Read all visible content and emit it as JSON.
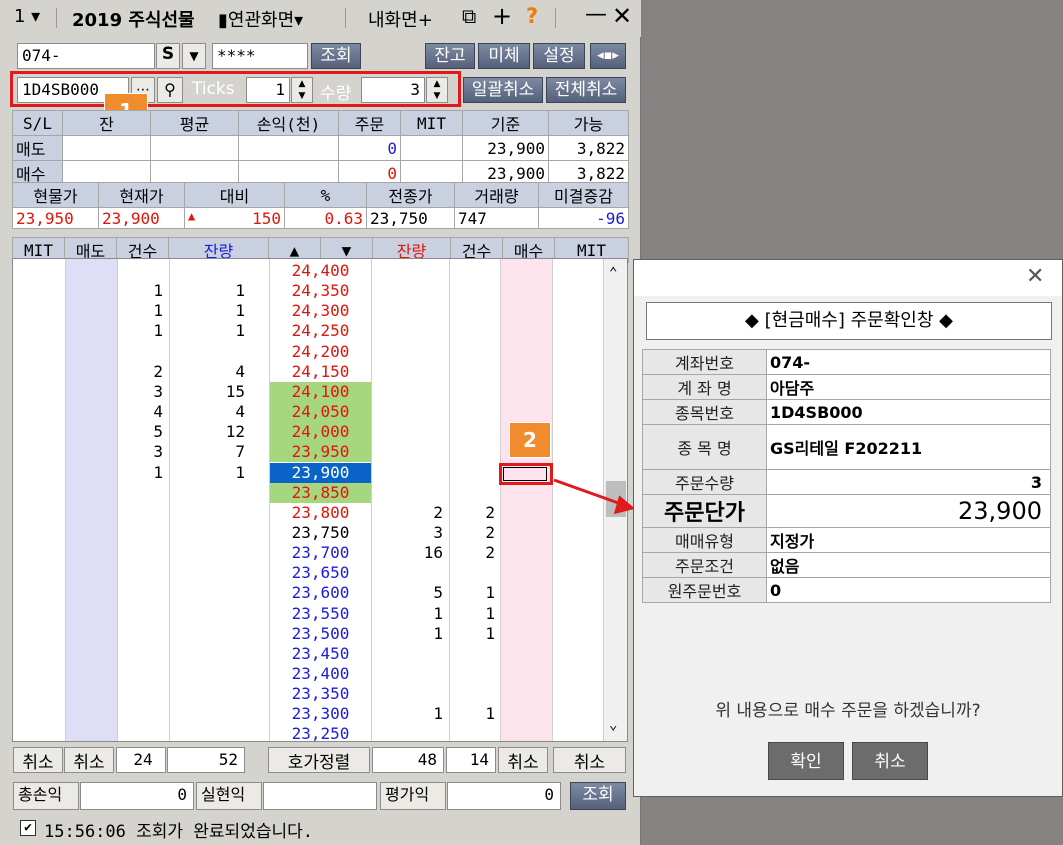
{
  "titlebar": {
    "menu_num": "1",
    "title": "2019 주식선물",
    "linked": "연관화면",
    "myscreen": "내화면",
    "help": "?"
  },
  "account": {
    "number": "074-",
    "s_label": "S",
    "password": "****",
    "inquiry_label": "조회",
    "balance_label": "잔고",
    "unfilled_label": "미체",
    "settings_label": "설정"
  },
  "order": {
    "code": "1D4SB000",
    "ticks_label": "Ticks",
    "ticks_value": "1",
    "qty_label": "수량",
    "qty_value": "3",
    "cancel_all_label": "일괄취소",
    "cancel_total_label": "전체취소"
  },
  "positions": {
    "headers": [
      "S/L",
      "잔",
      "평균",
      "손익(천)",
      "주문",
      "MIT",
      "기준",
      "가능"
    ],
    "rows": [
      {
        "side": "매도",
        "order": "0",
        "base": "23,900",
        "avail": "3,822"
      },
      {
        "side": "매수",
        "order": "0",
        "base": "23,900",
        "avail": "3,822"
      }
    ]
  },
  "quote": {
    "headers": [
      "현물가",
      "현재가",
      "대비",
      "%",
      "전종가",
      "거래량",
      "미결증감"
    ],
    "values": [
      "23,950",
      "23,900",
      "150",
      "0.63",
      "23,750",
      "747",
      "-96"
    ],
    "arrow": "▲"
  },
  "book_headers": [
    "MIT",
    "매도",
    "건수",
    "잔량",
    "▲",
    "▼",
    "잔량",
    "건수",
    "매수",
    "MIT"
  ],
  "book": [
    {
      "price": "24,400",
      "sc": "",
      "sq": "",
      "bq": "",
      "bc": "",
      "pc": "red",
      "hl": ""
    },
    {
      "price": "24,350",
      "sc": "1",
      "sq": "1",
      "bq": "",
      "bc": "",
      "pc": "red",
      "hl": ""
    },
    {
      "price": "24,300",
      "sc": "1",
      "sq": "1",
      "bq": "",
      "bc": "",
      "pc": "red",
      "hl": ""
    },
    {
      "price": "24,250",
      "sc": "1",
      "sq": "1",
      "bq": "",
      "bc": "",
      "pc": "red",
      "hl": ""
    },
    {
      "price": "24,200",
      "sc": "",
      "sq": "",
      "bq": "",
      "bc": "",
      "pc": "red",
      "hl": ""
    },
    {
      "price": "24,150",
      "sc": "2",
      "sq": "4",
      "bq": "",
      "bc": "",
      "pc": "red",
      "hl": ""
    },
    {
      "price": "24,100",
      "sc": "3",
      "sq": "15",
      "bq": "",
      "bc": "",
      "pc": "red",
      "hl": "green"
    },
    {
      "price": "24,050",
      "sc": "4",
      "sq": "4",
      "bq": "",
      "bc": "",
      "pc": "red",
      "hl": "green"
    },
    {
      "price": "24,000",
      "sc": "5",
      "sq": "12",
      "bq": "",
      "bc": "",
      "pc": "red",
      "hl": "green"
    },
    {
      "price": "23,950",
      "sc": "3",
      "sq": "7",
      "bq": "",
      "bc": "",
      "pc": "red",
      "hl": "green"
    },
    {
      "price": "23,900",
      "sc": "1",
      "sq": "1",
      "bq": "",
      "bc": "",
      "pc": "white",
      "hl": "blue"
    },
    {
      "price": "23,850",
      "sc": "",
      "sq": "",
      "bq": "",
      "bc": "",
      "pc": "red",
      "hl": "green"
    },
    {
      "price": "23,800",
      "sc": "",
      "sq": "",
      "bq": "2",
      "bc": "2",
      "pc": "red",
      "hl": ""
    },
    {
      "price": "23,750",
      "sc": "",
      "sq": "",
      "bq": "3",
      "bc": "2",
      "pc": "black",
      "hl": ""
    },
    {
      "price": "23,700",
      "sc": "",
      "sq": "",
      "bq": "16",
      "bc": "2",
      "pc": "blue",
      "hl": ""
    },
    {
      "price": "23,650",
      "sc": "",
      "sq": "",
      "bq": "",
      "bc": "",
      "pc": "blue",
      "hl": ""
    },
    {
      "price": "23,600",
      "sc": "",
      "sq": "",
      "bq": "5",
      "bc": "1",
      "pc": "blue",
      "hl": ""
    },
    {
      "price": "23,550",
      "sc": "",
      "sq": "",
      "bq": "1",
      "bc": "1",
      "pc": "blue",
      "hl": ""
    },
    {
      "price": "23,500",
      "sc": "",
      "sq": "",
      "bq": "1",
      "bc": "1",
      "pc": "blue",
      "hl": ""
    },
    {
      "price": "23,450",
      "sc": "",
      "sq": "",
      "bq": "",
      "bc": "",
      "pc": "blue",
      "hl": ""
    },
    {
      "price": "23,400",
      "sc": "",
      "sq": "",
      "bq": "",
      "bc": "",
      "pc": "blue",
      "hl": ""
    },
    {
      "price": "23,350",
      "sc": "",
      "sq": "",
      "bq": "",
      "bc": "",
      "pc": "blue",
      "hl": ""
    },
    {
      "price": "23,300",
      "sc": "",
      "sq": "",
      "bq": "1",
      "bc": "1",
      "pc": "blue",
      "hl": ""
    },
    {
      "price": "23,250",
      "sc": "",
      "sq": "",
      "bq": "",
      "bc": "",
      "pc": "blue",
      "hl": ""
    }
  ],
  "footer": {
    "cancel": "취소",
    "sell_count": "24",
    "sell_qty": "52",
    "sort_label": "호가정렬",
    "buy_qty": "48",
    "buy_count": "14"
  },
  "pnl": {
    "total_label": "총손익",
    "total_value": "0",
    "realized_label": "실현익",
    "eval_label": "평가익",
    "eval_value": "0",
    "inquiry_label": "조회"
  },
  "status": {
    "text": "15:56:06 조회가 완료되었습니다."
  },
  "badges": {
    "one": "1",
    "two": "2"
  },
  "dialog": {
    "title": "◆ [현금매수] 주문확인창 ◆",
    "rows": [
      {
        "label": "계좌번호",
        "value": "074-"
      },
      {
        "label": "계 좌 명",
        "value": "아담주"
      },
      {
        "label": "종목번호",
        "value": "1D4SB000"
      },
      {
        "label": "종 목 명",
        "value": "GS리테일 F202211"
      },
      {
        "label": "주문수량",
        "value": "3"
      },
      {
        "label": "주문단가",
        "value": "23,900"
      },
      {
        "label": "매매유형",
        "value": "지정가"
      },
      {
        "label": "주문조건",
        "value": "없음"
      },
      {
        "label": "원주문번호",
        "value": "0"
      }
    ],
    "question": "위 내용으로 매수 주문을 하겠습니까?",
    "ok_label": "확인",
    "cancel_label": "취소"
  },
  "colors": {
    "sell_col": "#dedef7",
    "buy_col": "#fde3ec",
    "price_green": "#a6d77e",
    "price_selected": "#0a64c8",
    "badge": "#f08c2d",
    "annotation_red": "#e01a1a"
  }
}
